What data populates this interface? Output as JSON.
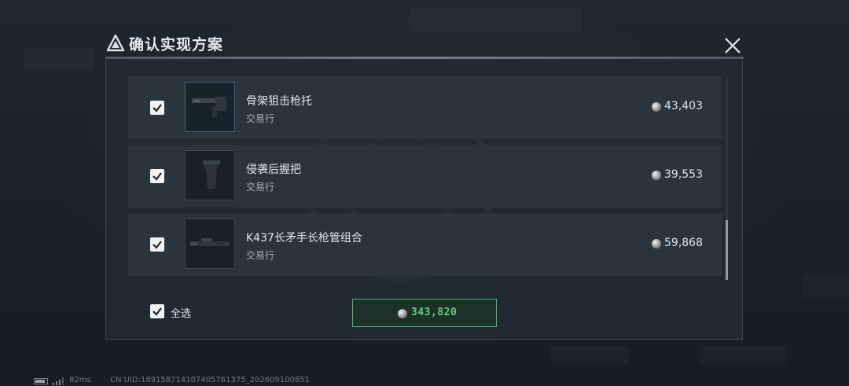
{
  "dialog": {
    "title": "确认实现方案"
  },
  "items": [
    {
      "name": "骨架狙击枪托",
      "source": "交易行",
      "price": "43,403",
      "checked": true
    },
    {
      "name": "侵袭后握把",
      "source": "交易行",
      "price": "39,553",
      "checked": true
    },
    {
      "name": "K437长矛手长枪管组合",
      "source": "交易行",
      "price": "59,868",
      "checked": true
    }
  ],
  "footer": {
    "select_all_label": "全选",
    "total": "343,820"
  },
  "status_bar": {
    "ping": "82ms",
    "uid": "CN UID:18915871410740576137​5_202609100851"
  },
  "colors": {
    "accent_green": "#5fd07f",
    "row_bg": "#29343d"
  }
}
